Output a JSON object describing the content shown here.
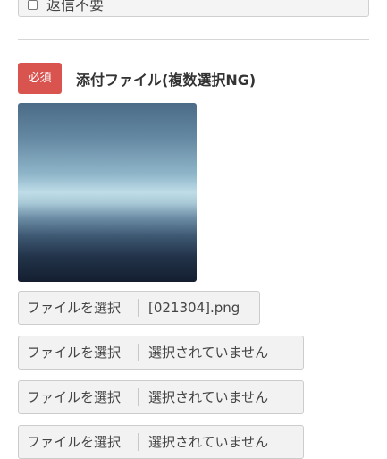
{
  "previous_field": {
    "checkbox_label": "返信不要",
    "checked": false
  },
  "attachment": {
    "required_badge": "必須",
    "label": "添付ファイル(複数選択NG)",
    "file_inputs": [
      {
        "button": "ファイルを選択",
        "filename": "[021304].png"
      },
      {
        "button": "ファイルを選択",
        "filename": "選択されていません"
      },
      {
        "button": "ファイルを選択",
        "filename": "選択されていません"
      },
      {
        "button": "ファイルを選択",
        "filename": "選択されていません"
      }
    ]
  },
  "colors": {
    "required": "#d9534f",
    "divider": "#d6d6d6",
    "input_bg": "#f2f2f2"
  }
}
